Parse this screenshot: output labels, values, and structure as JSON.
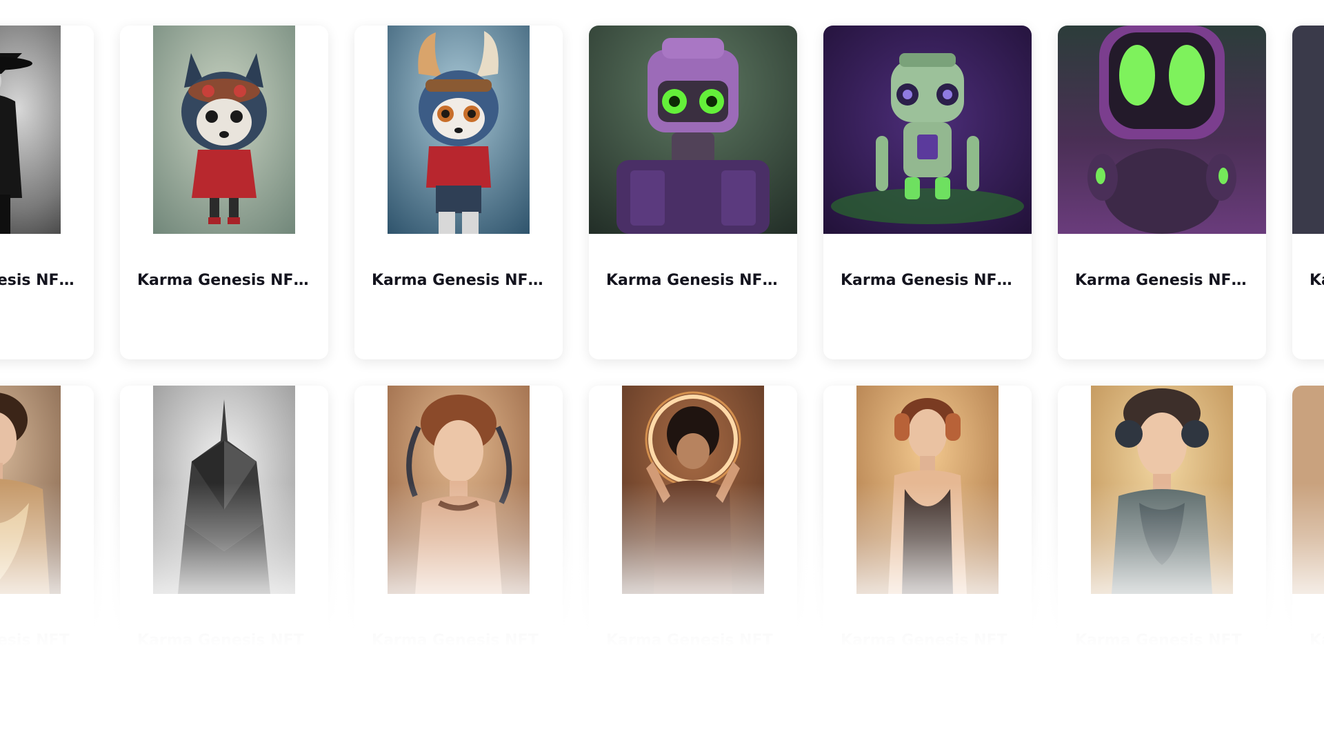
{
  "gallery": {
    "cards": [
      {
        "title": "Karma Genesis NFT ...",
        "image": "dark-pirate-figure-artwork"
      },
      {
        "title": "Karma Genesis NFT ...",
        "image": "steampunk-fox-artwork"
      },
      {
        "title": "Karma Genesis NFT ...",
        "image": "feathered-raccoon-artwork"
      },
      {
        "title": "Karma Genesis NFT ...",
        "image": "purple-robot-green-eyes-artwork"
      },
      {
        "title": "Karma Genesis NFT ...",
        "image": "green-robot-toy-artwork"
      },
      {
        "title": "Karma Genesis NFT ...",
        "image": "glossy-purple-robot-artwork"
      },
      {
        "title": "Karma Genesis NFT ...",
        "image": "offscreen-artwork"
      },
      {
        "title": "Karma Genesis NFT",
        "image": "woman-gold-dress-artwork"
      },
      {
        "title": "Karma Genesis NFT",
        "image": "geometric-mask-artwork"
      },
      {
        "title": "Karma Genesis NFT",
        "image": "cyborg-woman-cables-artwork"
      },
      {
        "title": "Karma Genesis NFT",
        "image": "woman-glowing-ring-artwork"
      },
      {
        "title": "Karma Genesis NFT",
        "image": "woman-headphones-artwork"
      },
      {
        "title": "Karma Genesis NFT",
        "image": "cyborg-woman-headset-artwork"
      },
      {
        "title": "Karma Genesis NFT",
        "image": "offscreen-artwork"
      }
    ]
  },
  "colors": {
    "title_text": "#14141e",
    "card_background": "#ffffff",
    "page_background": "#ffffff"
  }
}
